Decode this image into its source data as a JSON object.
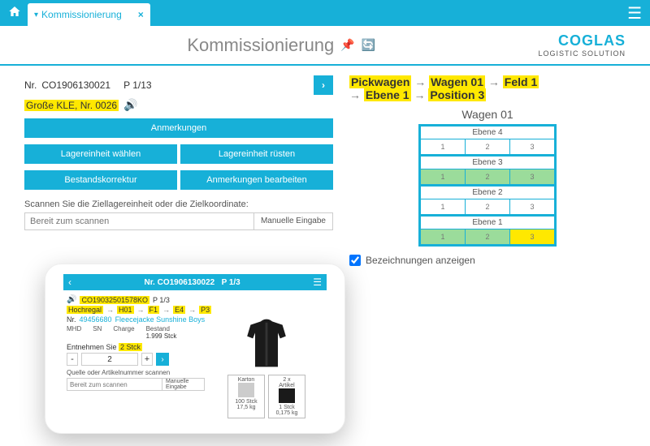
{
  "topbar": {
    "tab_label": "Kommissionierung",
    "tab_close": "×"
  },
  "header": {
    "title": "Kommissionierung",
    "logo_line1": "COGLAS",
    "logo_line2": "LOGISTIC SOLUTION"
  },
  "doc": {
    "nr_label": "Nr.",
    "nr_value": "CO1906130021",
    "page": "P 1/13",
    "highlight": "Große KLE, Nr. 0026"
  },
  "buttons": {
    "anmerkungen": "Anmerkungen",
    "lagereinheit_waehlen": "Lagereinheit wählen",
    "lagereinheit_ruesten": "Lagereinheit rüsten",
    "bestandskorrektur": "Bestandskorrektur",
    "anmerkungen_bearbeiten": "Anmerkungen bearbeiten"
  },
  "scan": {
    "label": "Scannen Sie die Ziellagereinheit oder die Zielkoordinate:",
    "placeholder": "Bereit zum scannen",
    "manual": "Manuelle Eingabe"
  },
  "breadcrumb": {
    "p1": "Pickwagen",
    "p2": "Wagen 01",
    "p3": "Feld 1",
    "p4": "Ebene 1",
    "p5": "Position 3",
    "arrow": "→"
  },
  "wagon": {
    "title": "Wagen 01",
    "ebenen": [
      {
        "label": "Ebene 4",
        "slots": [
          {
            "n": "1",
            "state": ""
          },
          {
            "n": "2",
            "state": ""
          },
          {
            "n": "3",
            "state": ""
          }
        ]
      },
      {
        "label": "Ebene 3",
        "slots": [
          {
            "n": "1",
            "state": "green"
          },
          {
            "n": "2",
            "state": "green"
          },
          {
            "n": "3",
            "state": "green"
          }
        ]
      },
      {
        "label": "Ebene 2",
        "slots": [
          {
            "n": "1",
            "state": ""
          },
          {
            "n": "2",
            "state": ""
          },
          {
            "n": "3",
            "state": ""
          }
        ]
      },
      {
        "label": "Ebene 1",
        "slots": [
          {
            "n": "1",
            "state": "green"
          },
          {
            "n": "2",
            "state": "green"
          },
          {
            "n": "3",
            "state": "yellow"
          }
        ]
      }
    ],
    "show_labels": "Bezeichnungen anzeigen"
  },
  "tablet": {
    "title_nr": "Nr. CO1906130022",
    "title_page": "P 1/3",
    "loc_id": "CO19032501578KO",
    "loc_page": "P 1/3",
    "bc": {
      "p1": "Hochregal",
      "p2": "H01",
      "p3": "F1",
      "p4": "E4",
      "p5": "P3"
    },
    "artnr_label": "Nr.",
    "artnr": "49456680",
    "artname": "Fleecejacke Sunshine Boys",
    "cols": {
      "mhd": "MHD",
      "sn": "SN",
      "charge": "Charge",
      "bestand": "Bestand",
      "bestand_val": "1.999 Stck"
    },
    "take_prefix": "Entnehmen Sie ",
    "take_qty": "2 Stck",
    "qty_value": "2",
    "scan_label": "Quelle oder Artikelnummer scannen",
    "scan_placeholder": "Bereit zum scannen",
    "manual": "Manuelle Eingabe",
    "card_karton": {
      "title": "Karton",
      "line1": "100 Stck",
      "line2": "17,5 kg"
    },
    "card_artikel": {
      "title_top": "2 x",
      "title": "Artikel",
      "line1": "1 Stck",
      "line2": "0,175 kg"
    }
  }
}
